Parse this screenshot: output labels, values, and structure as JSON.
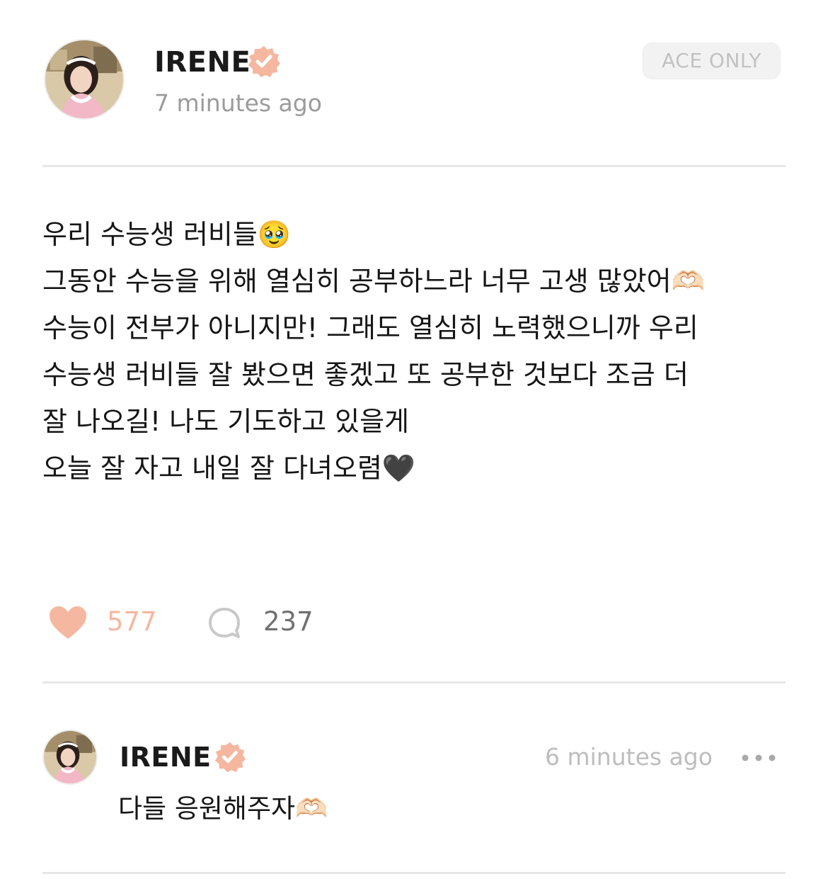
{
  "post": {
    "author": "IRENE",
    "time": "7 minutes ago",
    "tag": "ACE ONLY",
    "lines": [
      "우리 수능생 러비들🥹",
      "그동안 수능을 위해 열심히 공부하느라 너무 고생 많았어🫶🏻",
      "수능이 전부가 아니지만! 그래도 열심히 노력했으니까 우리",
      "수능생 러비들 잘 봤으면 좋겠고 또 공부한 것보다 조금 더",
      "잘 나오길! 나도 기도하고 있을게",
      "오늘 잘 자고 내일 잘 다녀오렴🖤"
    ],
    "likes": "577",
    "comments": "237"
  },
  "comment": {
    "author": "IRENE",
    "time": "6 minutes ago",
    "text": "다들 응원해주자🫶🏻"
  },
  "icons": {
    "verified": "verified-badge-icon",
    "like": "heart-icon",
    "comment": "speech-bubble-icon",
    "more": "more-options-icon"
  },
  "colors": {
    "accent": "#f5b7a0",
    "muted_text": "#9b9b9b",
    "tag_bg": "#f2f2f2",
    "divider": "#e7e7e7"
  }
}
